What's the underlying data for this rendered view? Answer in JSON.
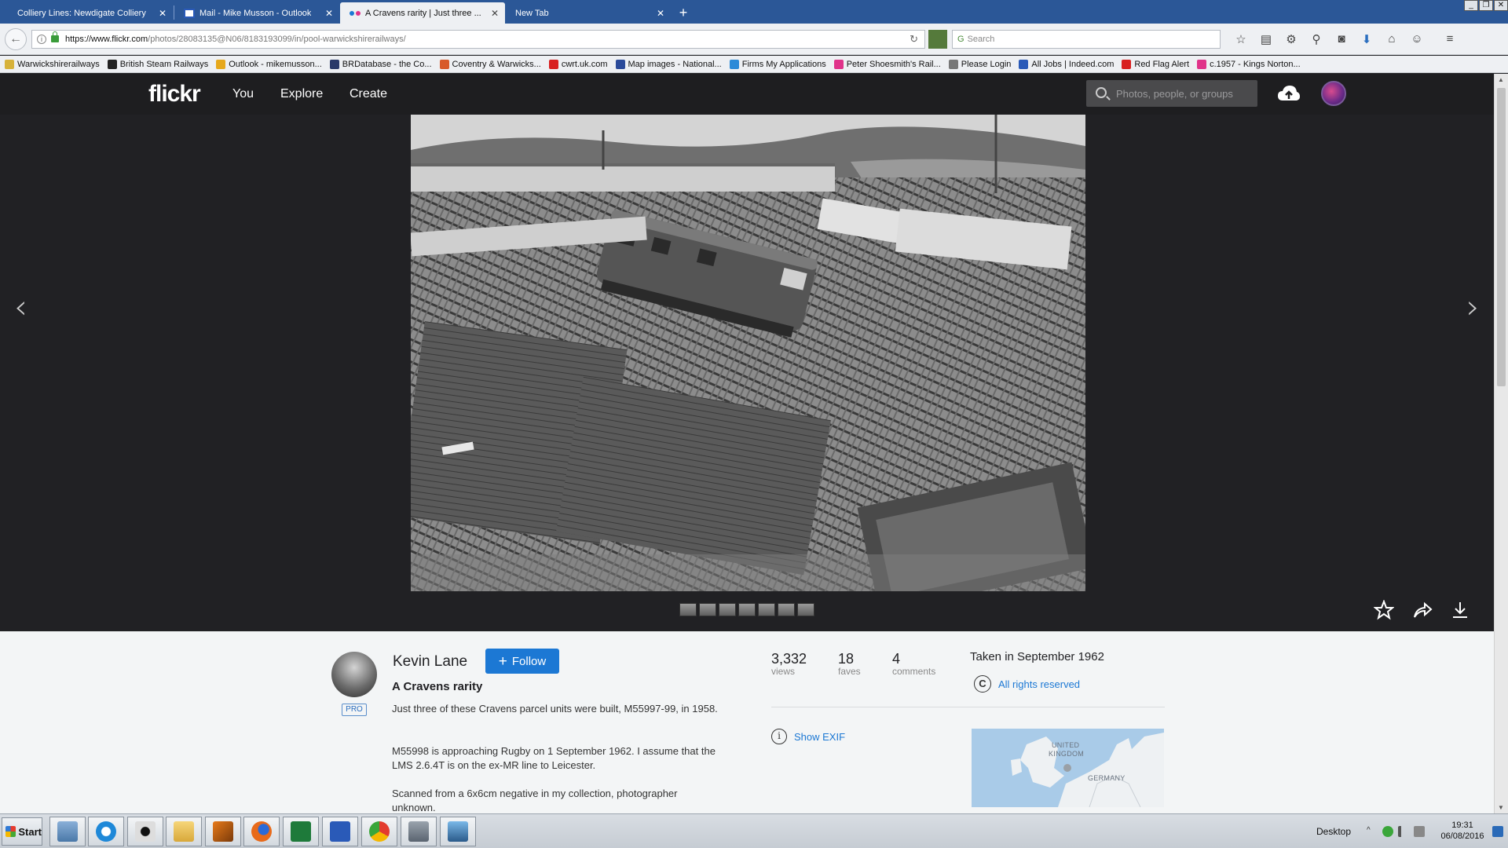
{
  "browser": {
    "tabs": [
      {
        "title": "Colliery Lines: Newdigate Colliery",
        "active": false
      },
      {
        "title": "Mail - Mike Musson - Outlook",
        "active": false
      },
      {
        "title": "A Cravens rarity | Just three ...",
        "active": true
      },
      {
        "title": "New Tab",
        "active": false
      }
    ],
    "new_tab": "+",
    "url_domain": "https://www.flickr.com",
    "url_path": "/photos/28083135@N06/8183193099/in/pool-warwickshirerailways/",
    "search_placeholder": "Search",
    "bookmarks": [
      {
        "label": "Warwickshirerailways",
        "color": "#d7b23a"
      },
      {
        "label": "British Steam Railways",
        "color": "#222222"
      },
      {
        "label": "Outlook - mikemusson...",
        "color": "#e6a81c"
      },
      {
        "label": "BRDatabase - the Co...",
        "color": "#2a3a6a"
      },
      {
        "label": "Coventry & Warwicks...",
        "color": "#d85a2a"
      },
      {
        "label": "cwrt.uk.com",
        "color": "#d82020"
      },
      {
        "label": "Map images - National...",
        "color": "#2a4a9a"
      },
      {
        "label": "Firms My Applications",
        "color": "#2a8ad8"
      },
      {
        "label": "Peter Shoesmith's Rail...",
        "color": "#e0338a"
      },
      {
        "label": "Please Login",
        "color": "#777777"
      },
      {
        "label": "All Jobs | Indeed.com",
        "color": "#2a5ab8"
      },
      {
        "label": "Red Flag Alert",
        "color": "#d82020"
      },
      {
        "label": "c.1957 - Kings Norton...",
        "color": "#e0338a"
      }
    ]
  },
  "flickr": {
    "logo": "flickr",
    "nav": [
      "You",
      "Explore",
      "Create"
    ],
    "search_placeholder": "Photos, people, or groups",
    "photo_alt": "A Cravens rarity",
    "owner": {
      "name": "Kevin Lane",
      "badge": "PRO",
      "follow_label": "Follow"
    },
    "photo": {
      "title": "A Cravens rarity",
      "description": [
        "Just three of these Cravens parcel units were built, M55997-99, in 1958.",
        "M55998 is approaching Rugby on 1 September 1962. I assume that the LMS 2.6.4T is on the ex-MR line to Leicester.",
        "Scanned from a 6x6cm negative in my collection, photographer unknown."
      ]
    },
    "stats": [
      {
        "value": "3,332",
        "label": "views"
      },
      {
        "value": "18",
        "label": "faves"
      },
      {
        "value": "4",
        "label": "comments"
      }
    ],
    "taken": "Taken in September 1962",
    "rights": "All rights reserved",
    "exif_label": "Show EXIF",
    "map_labels": [
      "UNITED",
      "KINGDOM",
      "GERMANY"
    ],
    "filmstrip_count": 7
  },
  "taskbar": {
    "start_label": "Start",
    "desktop_label": "Desktop",
    "time": "19:31",
    "date": "06/08/2016"
  }
}
